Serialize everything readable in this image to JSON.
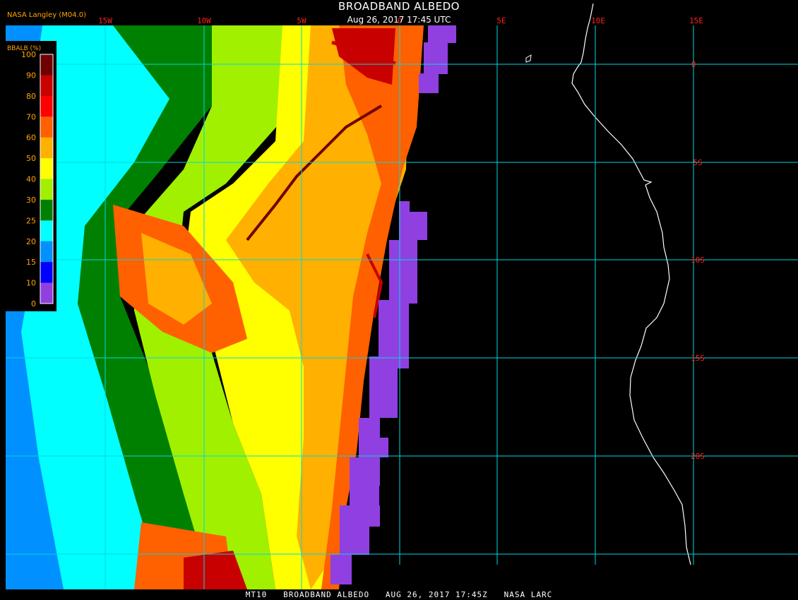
{
  "header": {
    "title": "BROADBAND ALBEDO",
    "timestamp": "Aug 26, 2017 17:45 UTC",
    "source": "NASA Langley (M04.0)"
  },
  "footer": {
    "caption": "MT10   BROADBAND ALBEDO   AUG 26, 2017 17:45Z   NASA LARC"
  },
  "legend": {
    "title": "BBALB (%)",
    "ticks": [
      "100",
      "90",
      "80",
      "70",
      "60",
      "50",
      "40",
      "30",
      "25",
      "20",
      "15",
      "10",
      "0"
    ],
    "colors": [
      "#700000",
      "#c80000",
      "#ff0000",
      "#ff6000",
      "#ffb000",
      "#ffff00",
      "#a0f000",
      "#008000",
      "#00ffff",
      "#0090ff",
      "#0000ff",
      "#9040e0"
    ]
  },
  "map": {
    "longitude_labels": [
      "15W",
      "10W",
      "5W",
      "0",
      "5E",
      "10E",
      "15E"
    ],
    "latitude_labels": [
      "0",
      "5S",
      "10S",
      "15S",
      "20S"
    ],
    "grid_color": "#00d8e0",
    "label_color": "#ff2020",
    "coast_color": "#ffffff"
  }
}
